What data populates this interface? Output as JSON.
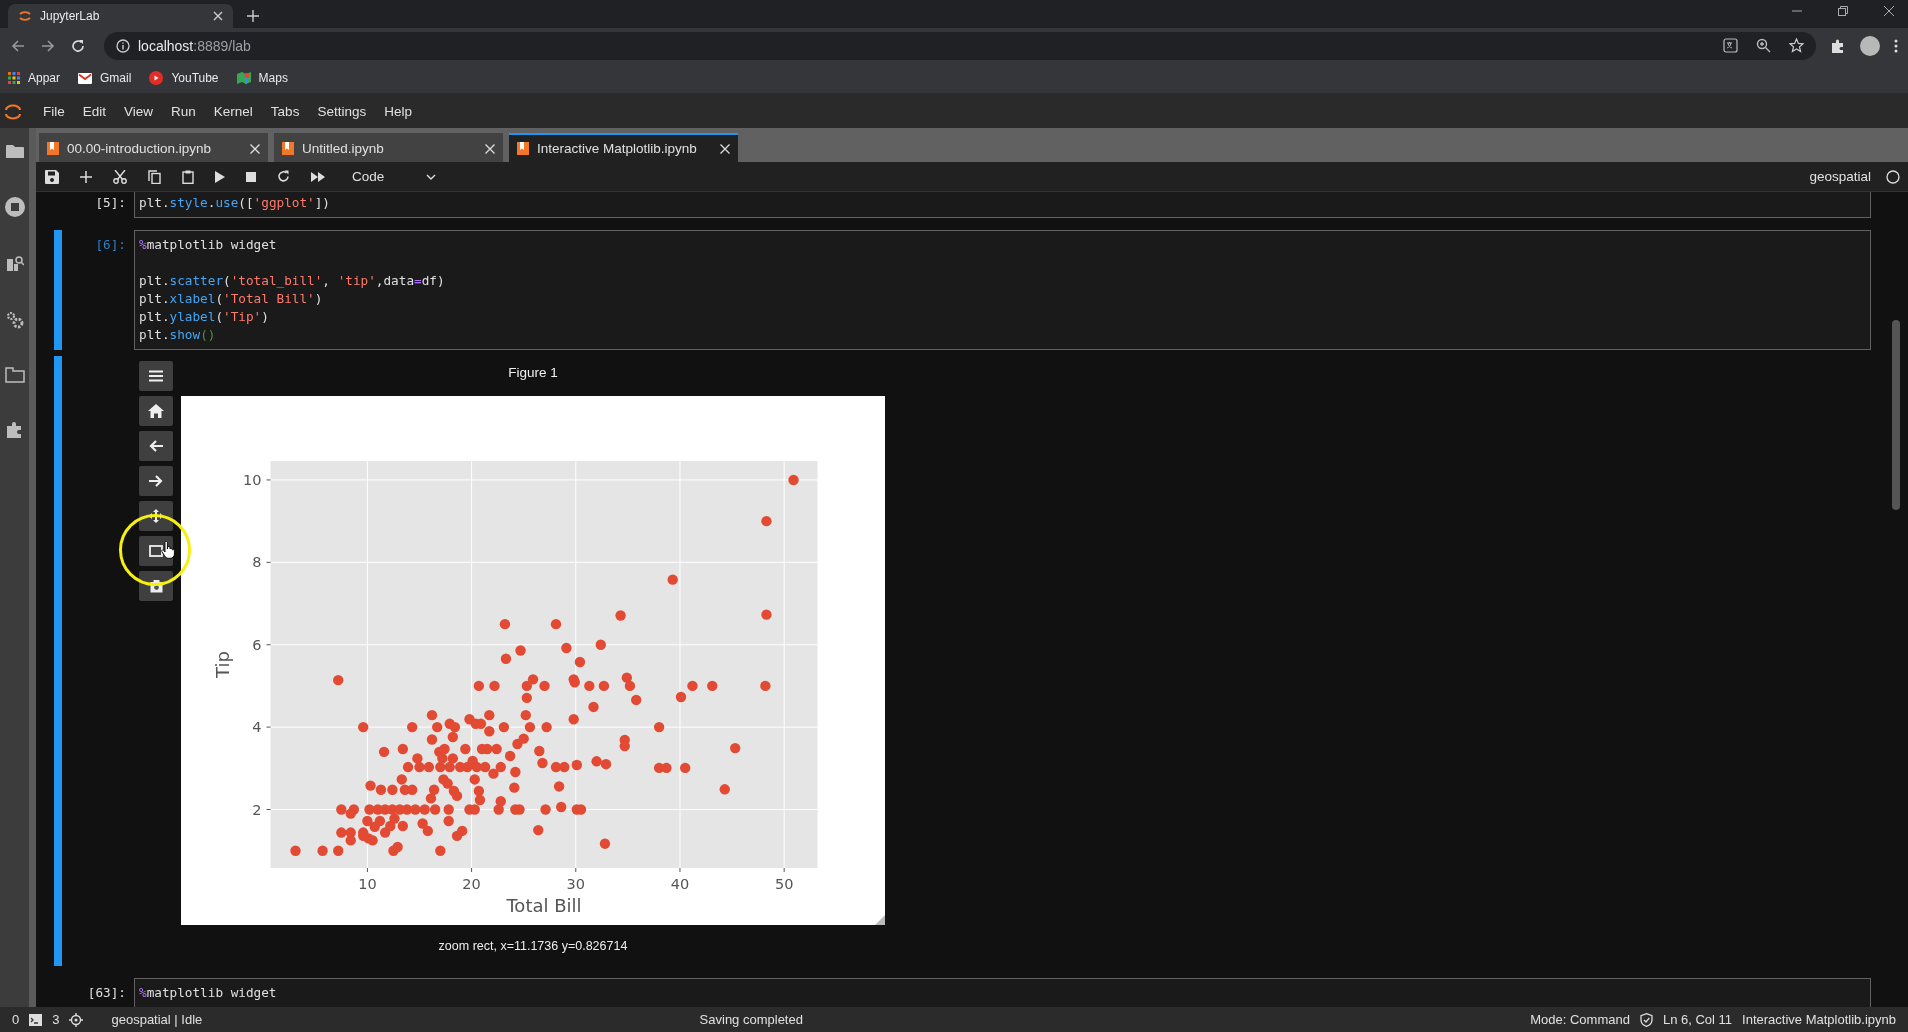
{
  "browser": {
    "tab_title": "JupyterLab",
    "url_host": "localhost",
    "url_rest": ":8889/lab",
    "bookmarks": [
      {
        "label": "Appar",
        "kind": "apps"
      },
      {
        "label": "Gmail",
        "kind": "gmail"
      },
      {
        "label": "YouTube",
        "kind": "youtube"
      },
      {
        "label": "Maps",
        "kind": "maps"
      }
    ]
  },
  "menu": [
    "File",
    "Edit",
    "View",
    "Run",
    "Kernel",
    "Tabs",
    "Settings",
    "Help"
  ],
  "dock_tabs": [
    {
      "label": "00.00-introduction.ipynb",
      "selected": false
    },
    {
      "label": "Untitled.ipynb",
      "selected": false
    },
    {
      "label": "Interactive Matplotlib.ipynb",
      "selected": true
    }
  ],
  "toolbar": {
    "cell_type": "Code",
    "kernel": "geospatial"
  },
  "cells": [
    {
      "prompt": "[5]:",
      "active": false,
      "lines": [
        {
          "tokens": [
            {
              "t": "plt.",
              "kind": "plain"
            },
            {
              "t": "style",
              "kind": "name"
            },
            {
              "t": ".",
              "kind": "plain"
            },
            {
              "t": "use",
              "kind": "name"
            },
            {
              "t": "([",
              "kind": "plain"
            },
            {
              "t": "'ggplot'",
              "kind": "string"
            },
            {
              "t": "])",
              "kind": "plain"
            }
          ]
        }
      ]
    },
    {
      "prompt": "[6]:",
      "active": true,
      "lines": [
        {
          "tokens": [
            {
              "t": "%",
              "kind": "magic"
            },
            {
              "t": "matplotlib widget",
              "kind": "plain"
            }
          ]
        },
        {
          "blank": true
        },
        {
          "tokens": [
            {
              "t": "plt.",
              "kind": "plain"
            },
            {
              "t": "scatter",
              "kind": "name"
            },
            {
              "t": "(",
              "kind": "plain"
            },
            {
              "t": "'total_bill'",
              "kind": "string"
            },
            {
              "t": ", ",
              "kind": "plain"
            },
            {
              "t": "'tip'",
              "kind": "string"
            },
            {
              "t": ",data",
              "kind": "plain"
            },
            {
              "t": "=",
              "kind": "operator"
            },
            {
              "t": "df)",
              "kind": "plain"
            }
          ]
        },
        {
          "tokens": [
            {
              "t": "plt.",
              "kind": "plain"
            },
            {
              "t": "xlabel",
              "kind": "name"
            },
            {
              "t": "(",
              "kind": "plain"
            },
            {
              "t": "'Total Bill'",
              "kind": "string"
            },
            {
              "t": ")",
              "kind": "plain"
            }
          ]
        },
        {
          "tokens": [
            {
              "t": "plt.",
              "kind": "plain"
            },
            {
              "t": "ylabel",
              "kind": "name"
            },
            {
              "t": "(",
              "kind": "plain"
            },
            {
              "t": "'Tip'",
              "kind": "string"
            },
            {
              "t": ")",
              "kind": "plain"
            }
          ]
        },
        {
          "tokens": [
            {
              "t": "plt.",
              "kind": "plain"
            },
            {
              "t": "show",
              "kind": "name"
            },
            {
              "t": "()",
              "kind": "match"
            }
          ]
        }
      ],
      "figure": {
        "title": "Figure 1",
        "tools": [
          {
            "kind": "menu"
          },
          {
            "kind": "home"
          },
          {
            "kind": "back"
          },
          {
            "kind": "forward"
          },
          {
            "kind": "move"
          },
          {
            "kind": "zoom"
          },
          {
            "kind": "save"
          }
        ],
        "message": "zoom rect, x=11.1736 y=0.826714",
        "chart_data": {
          "type": "scatter",
          "grid": true,
          "xlabel": "Total Bill",
          "ylabel": "Tip",
          "xlim": [
            0.7,
            53.2
          ],
          "ylim": [
            0.58,
            10.46
          ],
          "xticks": [
            10,
            20,
            30,
            40,
            50
          ],
          "yticks": [
            2,
            4,
            6,
            8,
            10
          ],
          "x": [
            3.1,
            5.7,
            7.2,
            7.2,
            9.6,
            7.5,
            7.5,
            8.4,
            8.4,
            8.7,
            8.4,
            9.6,
            9.6,
            10.0,
            10.2,
            10.3,
            10.1,
            10.5,
            10.7,
            11.0,
            11.2,
            11.3,
            11.6,
            11.7,
            11.7,
            12.2,
            12.4,
            12.4,
            12.5,
            12.6,
            12.9,
            13.1,
            13.3,
            13.4,
            13.4,
            13.6,
            13.8,
            13.9,
            14.3,
            14.3,
            14.6,
            14.8,
            15.0,
            15.3,
            15.5,
            15.8,
            15.9,
            16.1,
            16.2,
            16.2,
            16.4,
            16.5,
            16.7,
            16.9,
            17.0,
            17.0,
            17.2,
            17.3,
            17.4,
            17.7,
            17.8,
            17.8,
            17.9,
            17.9,
            18.2,
            18.2,
            18.3,
            18.4,
            18.6,
            18.6,
            18.9,
            19.1,
            19.4,
            19.6,
            19.8,
            19.8,
            20.1,
            20.3,
            20.3,
            20.4,
            20.5,
            20.7,
            20.7,
            20.8,
            20.9,
            21.0,
            21.3,
            21.5,
            21.7,
            21.7,
            22.1,
            22.2,
            22.4,
            22.6,
            22.8,
            22.8,
            23.1,
            23.2,
            23.3,
            23.7,
            24.1,
            24.2,
            24.2,
            24.4,
            24.6,
            24.7,
            25.0,
            25.2,
            25.3,
            25.3,
            25.6,
            25.9,
            26.4,
            26.5,
            26.8,
            27.0,
            27.1,
            27.2,
            28.1,
            28.1,
            28.4,
            28.6,
            28.9,
            29.1,
            29.8,
            29.8,
            29.9,
            30.1,
            30.1,
            30.4,
            30.5,
            31.3,
            31.7,
            32.0,
            32.4,
            32.7,
            32.8,
            32.9,
            34.3,
            34.7,
            34.7,
            34.9,
            35.2,
            35.8,
            38.0,
            38.0,
            38.7,
            39.3,
            40.1,
            40.5,
            41.2,
            43.1,
            44.3,
            45.3,
            48.2,
            48.3,
            48.3,
            50.9
          ],
          "series": [
            {
              "color": "#e24a33",
              "values": [
                1.0,
                1.0,
                1.0,
                5.14,
                4.0,
                2.0,
                1.44,
                1.44,
                1.25,
                2.0,
                1.9,
                1.44,
                1.36,
                1.72,
                2.0,
                2.58,
                1.3,
                1.25,
                1.58,
                2.0,
                1.72,
                2.48,
                3.4,
                2.0,
                1.44,
                1.6,
                2.0,
                2.48,
                1.0,
                1.78,
                1.09,
                2.0,
                2.73,
                3.47,
                1.6,
                2.48,
                2.0,
                3.03,
                4.0,
                2.48,
                2.0,
                3.24,
                3.03,
                1.66,
                2.0,
                1.48,
                3.03,
                2.27,
                4.29,
                3.7,
                2.48,
                2.0,
                4.0,
                3.4,
                1.0,
                3.03,
                3.24,
                2.73,
                3.47,
                2.63,
                2.0,
                1.72,
                4.08,
                3.03,
                3.76,
                3.24,
                2.45,
                4.0,
                2.33,
                1.36,
                3.03,
                1.48,
                3.47,
                3.03,
                4.19,
                2.0,
                3.18,
                2.0,
                2.73,
                4.08,
                3.03,
                5.0,
                2.45,
                2.23,
                4.08,
                3.47,
                3.03,
                3.47,
                4.29,
                3.9,
                2.87,
                5.0,
                3.47,
                2.0,
                2.2,
                3.03,
                4.0,
                6.5,
                5.66,
                3.3,
                2.53,
                2.91,
                2.0,
                3.59,
                2.0,
                5.86,
                3.72,
                4.29,
                4.71,
                5.0,
                4.0,
                5.16,
                1.5,
                3.42,
                3.13,
                5.0,
                2.0,
                4.0,
                6.5,
                3.03,
                2.56,
                2.06,
                3.03,
                5.92,
                4.19,
                5.16,
                5.09,
                2.0,
                3.08,
                5.58,
                2.0,
                5.0,
                4.49,
                3.17,
                6.0,
                5.0,
                1.17,
                3.1,
                6.71,
                3.69,
                3.54,
                5.2,
                5.0,
                4.66,
                4.0,
                3.01,
                3.01,
                7.58,
                4.73,
                3.01,
                5.0,
                5.0,
                2.49,
                3.49,
                5.0,
                6.73,
                9.0,
                10.0
              ]
            }
          ]
        }
      }
    },
    {
      "prompt": "[63]:",
      "active": false,
      "lines": [
        {
          "tokens": [
            {
              "t": "%",
              "kind": "magic"
            },
            {
              "t": "matplotlib widget",
              "kind": "plain"
            }
          ]
        }
      ]
    }
  ],
  "status_bar": {
    "terminals": "0",
    "kernels": "3",
    "kernel_status": "geospatial | Idle",
    "message": "Saving completed",
    "mode": "Mode: Command",
    "cursor": "Ln 6, Col 11",
    "file": "Interactive Matplotlib.ipynb"
  }
}
